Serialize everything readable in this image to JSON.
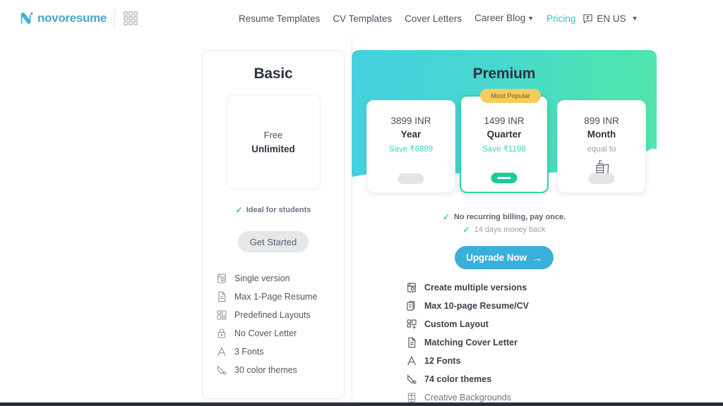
{
  "brand": {
    "name": "novoresume",
    "logo_icon": "novoresume-n-logo",
    "grid_icon": "apps-grid-icon"
  },
  "nav": {
    "items": [
      {
        "label": "Resume Templates",
        "active": false,
        "caret": false
      },
      {
        "label": "CV Templates",
        "active": false,
        "caret": false
      },
      {
        "label": "Cover Letters",
        "active": false,
        "caret": false
      },
      {
        "label": "Career Blog",
        "active": false,
        "caret": true
      },
      {
        "label": "Pricing",
        "active": true,
        "caret": false
      }
    ],
    "language": {
      "label": "EN US",
      "icon": "language-translate-icon",
      "caret": "▼"
    },
    "caret_glyph": "▼"
  },
  "basic": {
    "title": "Basic",
    "price_label": "Free",
    "price_value": "Unlimited",
    "note": "Ideal for students",
    "cta": "Get Started",
    "features": [
      {
        "label": "Single version",
        "icon": "single-version-icon"
      },
      {
        "label": "Max 1-Page Resume",
        "icon": "document-page-icon"
      },
      {
        "label": "Predefined Layouts",
        "icon": "layout-grid-icon"
      },
      {
        "label": "No Cover Letter",
        "icon": "lock-icon"
      },
      {
        "label": "3 Fonts",
        "icon": "font-a-icon"
      },
      {
        "label": "30 color themes",
        "icon": "pen-color-icon"
      }
    ]
  },
  "premium": {
    "title": "Premium",
    "badge": "Most Popular",
    "plans": [
      {
        "price": "3899 INR",
        "period": "Year",
        "sub": "Save ₹6889",
        "sub_kind": "save",
        "selected": false
      },
      {
        "price": "1499 INR",
        "period": "Quarter",
        "sub": "Save ₹1198",
        "sub_kind": "save",
        "selected": true
      },
      {
        "price": "899 INR",
        "period": "Month",
        "sub": "equal to",
        "sub_kind": "equal",
        "selected": false,
        "icon": "burger-meal-icon"
      }
    ],
    "checks": [
      {
        "label": "No recurring billing, pay once.",
        "emphasis": true
      },
      {
        "label": "14 days money back",
        "emphasis": false
      }
    ],
    "cta": "Upgrade Now",
    "cta_arrow": "→",
    "features": [
      {
        "label": "Create multiple versions",
        "icon": "multiple-versions-icon",
        "muted": false
      },
      {
        "label": "Max 10-page Resume/CV",
        "icon": "multi-page-document-icon",
        "muted": false
      },
      {
        "label": "Custom Layout",
        "icon": "layout-add-icon",
        "muted": false
      },
      {
        "label": "Matching Cover Letter",
        "icon": "document-page-icon",
        "muted": false
      },
      {
        "label": "12 Fonts",
        "icon": "font-a-icon",
        "muted": false
      },
      {
        "label": "74 color themes",
        "icon": "pen-color-icon",
        "muted": false
      },
      {
        "label": "Creative Backgrounds",
        "icon": "creative-background-icon",
        "muted": true
      }
    ]
  },
  "colors": {
    "accent_teal": "#2ec5b6",
    "accent_blue": "#3aafd9",
    "gradient_start": "#45cfe0",
    "gradient_end": "#52e5ad",
    "badge_yellow": "#f7cc5c",
    "check_green": "#2ecfa0",
    "selected_radio": "#1ec99a"
  },
  "check_glyph": "✓"
}
